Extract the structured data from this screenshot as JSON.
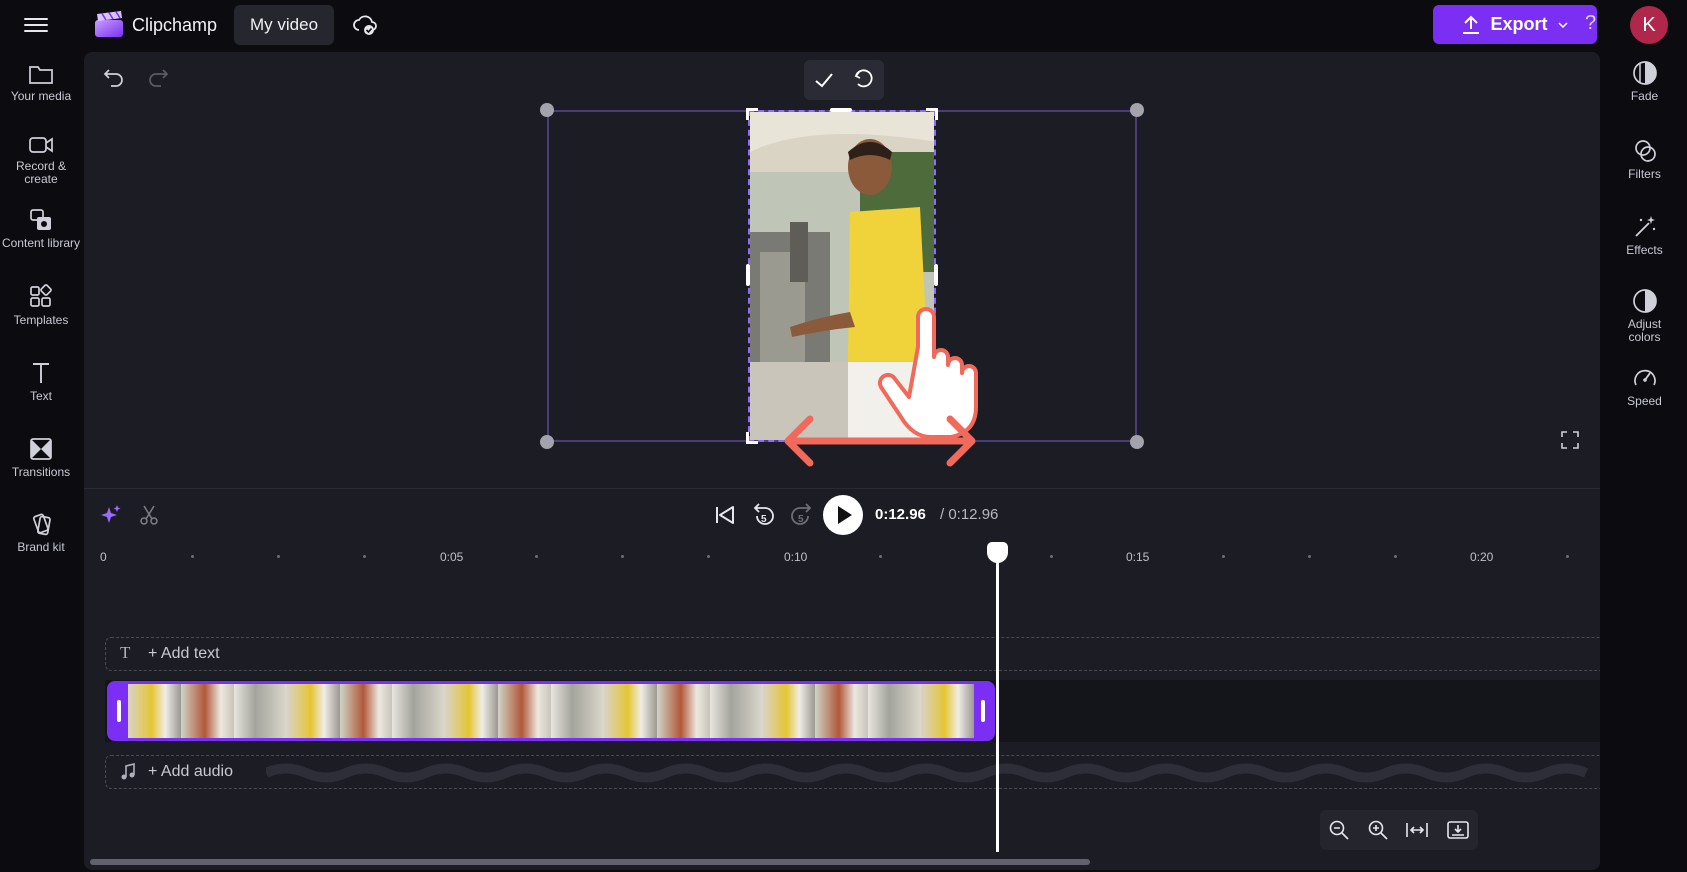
{
  "app": {
    "name": "Clipchamp",
    "project_title": "My video"
  },
  "header": {
    "export_label": "Export",
    "help_label": "?",
    "avatar_initial": "K"
  },
  "left_sidebar": {
    "items": [
      {
        "label": "Your media",
        "icon": "folder-icon"
      },
      {
        "label": "Record & create",
        "icon": "camera-icon"
      },
      {
        "label": "Content library",
        "icon": "content-library-icon"
      },
      {
        "label": "Templates",
        "icon": "templates-icon"
      },
      {
        "label": "Text",
        "icon": "text-icon"
      },
      {
        "label": "Transitions",
        "icon": "transitions-icon"
      },
      {
        "label": "Brand kit",
        "icon": "brand-kit-icon"
      }
    ]
  },
  "right_sidebar": {
    "items": [
      {
        "label": "Fade",
        "icon": "fade-icon"
      },
      {
        "label": "Filters",
        "icon": "filters-icon"
      },
      {
        "label": "Effects",
        "icon": "effects-icon"
      },
      {
        "label": "Adjust colors",
        "icon": "adjust-colors-icon"
      },
      {
        "label": "Speed",
        "icon": "speed-icon"
      }
    ]
  },
  "playback": {
    "current_time": "0:12.96",
    "total_time": "/ 0:12.96",
    "rewind_seconds": "5",
    "forward_seconds": "5"
  },
  "timeline": {
    "ruler_labels": [
      "0",
      "0:05",
      "0:10",
      "0:15",
      "0:20"
    ],
    "add_text_label": "+ Add text",
    "add_audio_label": "+ Add audio"
  },
  "colors": {
    "accent": "#7b2ff2",
    "background": "#0b0b10",
    "workspace": "#1c1c24",
    "avatar": "#b1264b",
    "annotation": "#f0695a"
  }
}
